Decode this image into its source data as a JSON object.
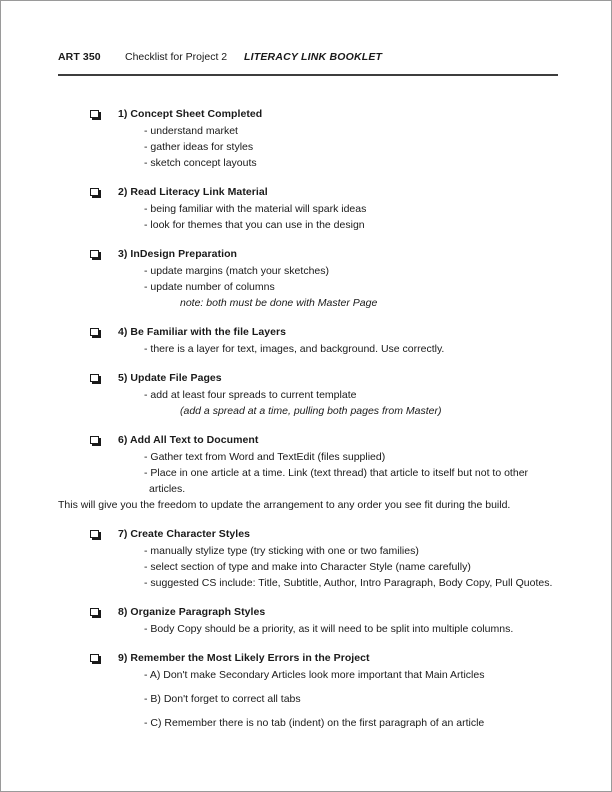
{
  "document": {
    "header": {
      "course": "ART 350",
      "subtitle": "Checklist for Project 2",
      "title": "LITERACY LINK BOOKLET"
    },
    "items": [
      {
        "heading": "1) Concept Sheet Completed",
        "lines": [
          {
            "text": "- understand market",
            "style": "sub"
          },
          {
            "text": "- gather ideas for styles",
            "style": "sub"
          },
          {
            "text": "- sketch concept layouts",
            "style": "sub"
          }
        ]
      },
      {
        "heading": "2) Read Literacy Link Material",
        "lines": [
          {
            "text": "- being familiar with the material will spark ideas",
            "style": "sub"
          },
          {
            "text": "- look for themes that you can use in the design",
            "style": "sub"
          }
        ]
      },
      {
        "heading": "3) InDesign Preparation",
        "lines": [
          {
            "text": "- update margins (match your sketches)",
            "style": "sub"
          },
          {
            "text": "- update number of columns",
            "style": "sub"
          },
          {
            "text": "note: both must be done with Master Page",
            "style": "note"
          }
        ]
      },
      {
        "heading": "4) Be Familiar with the file Layers",
        "lines": [
          {
            "text": "- there is a layer for text, images, and background. Use correctly.",
            "style": "sub"
          }
        ]
      },
      {
        "heading": "5) Update File Pages",
        "lines": [
          {
            "text": "- add at least four spreads to current template",
            "style": "sub"
          },
          {
            "text": "(add a spread at a time, pulling both pages from Master)",
            "style": "note"
          }
        ]
      },
      {
        "heading": "6) Add All Text to Document",
        "lines": [
          {
            "text": "- Gather text from Word and TextEdit (files supplied)",
            "style": "sub"
          },
          {
            "text": "- Place in one article at a time. Link (text thread) that article to itself but not to other articles.",
            "style": "sub"
          },
          {
            "text": "This will give you the freedom to update the arrangement to any order you see fit during the build.",
            "style": "full"
          }
        ]
      },
      {
        "heading": "7) Create Character Styles",
        "lines": [
          {
            "text": "- manually stylize type (try sticking with one or two families)",
            "style": "sub"
          },
          {
            "text": "- select section of type and make into Character Style (name carefully)",
            "style": "sub"
          },
          {
            "text": "- suggested CS include: Title, Subtitle, Author, Intro Paragraph, Body Copy, Pull Quotes.",
            "style": "sub"
          }
        ]
      },
      {
        "heading": "8) Organize Paragraph Styles",
        "lines": [
          {
            "text": "- Body Copy should be a priority, as it will need to be split into multiple columns.",
            "style": "sub"
          }
        ]
      },
      {
        "heading": "9) Remember the Most Likely Errors in the Project",
        "lines": [
          {
            "text": "- A) Don't make Secondary Articles look more important that Main Articles",
            "style": "sub"
          },
          {
            "text": "- B) Don't forget to correct all tabs",
            "style": "sub spaced"
          },
          {
            "text": "- C) Remember there is no tab (indent) on the first paragraph of an article",
            "style": "sub spaced"
          }
        ]
      }
    ]
  }
}
